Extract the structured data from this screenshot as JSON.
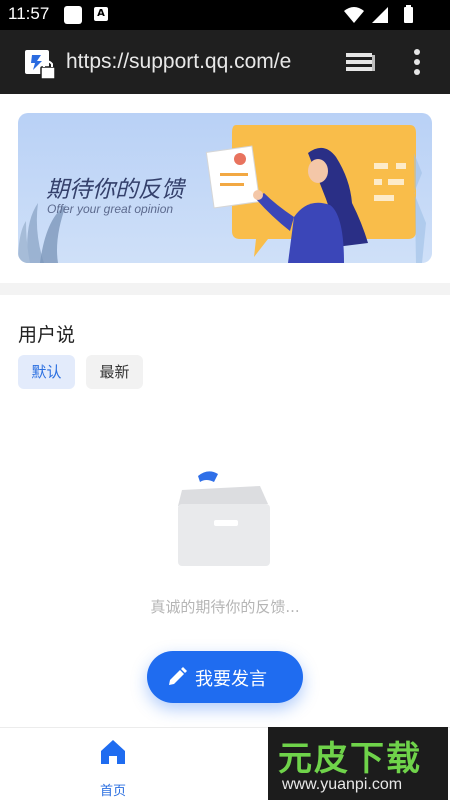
{
  "status_bar": {
    "time": "11:57",
    "notification_icon": "a-letter-icon",
    "icons": [
      "wifi-icon",
      "signal-icon",
      "battery-icon"
    ]
  },
  "browser": {
    "url": "https://support.qq.com/e",
    "site_icon": "site-secure-icon",
    "tabs_icon": "tabs-icon",
    "menu_icon": "overflow-menu-icon"
  },
  "banner": {
    "title": "期待你的反馈",
    "subtitle": "Offer your great opinion"
  },
  "section": {
    "title": "用户说",
    "tabs": [
      {
        "label": "默认",
        "selected": true
      },
      {
        "label": "最新",
        "selected": false
      }
    ]
  },
  "empty_state": {
    "text": "真诚的期待你的反馈..."
  },
  "post_button": {
    "label": "我要发言",
    "icon": "pencil-icon"
  },
  "bottom_nav": {
    "items": [
      {
        "label": "首页",
        "icon": "home-icon",
        "active": true
      }
    ]
  },
  "watermark": {
    "logo": "元皮下载",
    "url": "www.yuanpi.com"
  },
  "colors": {
    "accent": "#1f6cf0",
    "banner_bg": "#c6dbf7",
    "tab_selected_bg": "#e3ebfb",
    "watermark_green": "#6fd34a"
  }
}
